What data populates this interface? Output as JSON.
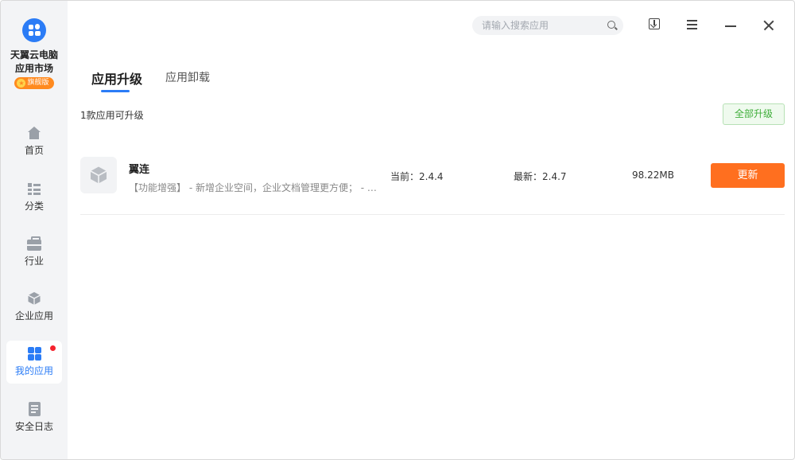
{
  "brand": {
    "title_line1": "天翼云电脑",
    "title_line2": "应用市场",
    "badge": "旗舰版"
  },
  "nav": [
    {
      "label": "首页",
      "icon": "home-icon"
    },
    {
      "label": "分类",
      "icon": "category-icon"
    },
    {
      "label": "行业",
      "icon": "briefcase-icon"
    },
    {
      "label": "企业应用",
      "icon": "cube-icon"
    },
    {
      "label": "我的应用",
      "icon": "apps-icon",
      "active": true,
      "has_dot": true
    },
    {
      "label": "安全日志",
      "icon": "log-icon"
    }
  ],
  "search": {
    "placeholder": "请输入搜索应用",
    "value": ""
  },
  "tabs": [
    {
      "label": "应用升级",
      "active": true
    },
    {
      "label": "应用卸载",
      "active": false
    }
  ],
  "summary": {
    "count_text": "1款应用可升级",
    "upgrade_all_label": "全部升级"
  },
  "apps": [
    {
      "name": "翼连",
      "description": "【功能增强】 - 新增企业空间，企业文档管理更方便； - 新增会议功能",
      "current_version": "当前：2.4.4",
      "latest_version": "最新：2.4.7",
      "size": "98.22MB",
      "update_label": "更新"
    }
  ],
  "colors": {
    "accent": "#2b7cf6",
    "update_button": "#ff6f1f",
    "upgrade_all_text": "#3fae3a",
    "badge": "#ff8a1f",
    "sidebar_bg": "#f3f4f6"
  }
}
